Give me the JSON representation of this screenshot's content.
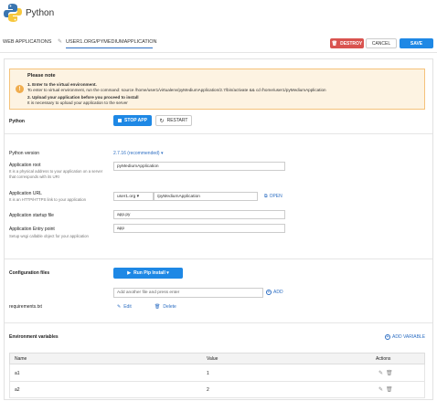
{
  "header": {
    "title": "Python"
  },
  "tabs": {
    "web_apps": "WEB APPLICATIONS",
    "current": "USER1.ORG/PYMEDIUMAPPLICATION"
  },
  "actions": {
    "destroy": "DESTROY",
    "cancel": "CANCEL",
    "save": "SAVE"
  },
  "note": {
    "title": "Please note",
    "step1_title": "1. Enter to the virtual environment.",
    "step1_text": "To enter to virtual environment, run the command: source /home/user1/virtualenv/pyMediumApplication/2.7/bin/activate && cd /home/user1/pyMediumApplication",
    "step2_title": "2. Upload your application before you proceed to install",
    "step2_text": "It is necessary to upload your application to the server"
  },
  "python": {
    "label": "Python",
    "stop_app": "STOP APP",
    "restart": "RESTART"
  },
  "form": {
    "version_label": "Python version",
    "version_value": "2.7.16 (recommended) ▾",
    "root_label": "Application root",
    "root_help": "It is a physical address to your application on a server that corresponds with its URI",
    "root_value": "pyMediumApplication",
    "url_label": "Application URL",
    "url_help": "It is an HTTP/HTTPS link to your application",
    "url_domain": "user1.org ▾",
    "url_value": "/pyMediumApplication",
    "open_label": "OPEN",
    "startup_label": "Application startup file",
    "startup_value": "app.py",
    "entry_label": "Application Entry point",
    "entry_help": "Setup wsgi callable object for your application",
    "entry_value": "app"
  },
  "config": {
    "label": "Configuration files",
    "run_pip": "Run Pip Install ▾",
    "add_placeholder": "Add another file and press enter",
    "add_label": "ADD",
    "file_name": "requirements.txt",
    "edit_label": "Edit",
    "delete_label": "Delete"
  },
  "env": {
    "label": "Environment variables",
    "add_variable": "ADD VARIABLE",
    "columns": [
      "Name",
      "Value",
      "Actions"
    ],
    "rows": [
      {
        "name": "a1",
        "value": "1"
      },
      {
        "name": "a2",
        "value": "2"
      }
    ]
  }
}
